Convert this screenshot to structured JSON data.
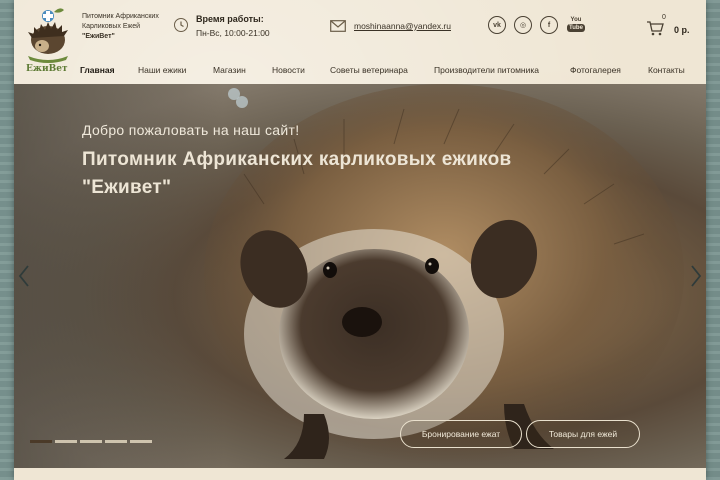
{
  "logo": {
    "name": "ЕжиВет",
    "text_line1": "Питомник Африканских",
    "text_line2": "Карликовых Ежей",
    "text_line3": "\"ЕжиВет\""
  },
  "hours": {
    "title": "Время работы:",
    "value": "Пн-Вс, 10:00-21:00"
  },
  "email": "moshinaanna@yandex.ru",
  "socials": [
    {
      "name": "vk",
      "label": "vk"
    },
    {
      "name": "instagram",
      "label": "◎"
    },
    {
      "name": "facebook",
      "label": "f"
    },
    {
      "name": "youtube",
      "label_top": "You",
      "label_bottom": "Tube"
    }
  ],
  "cart": {
    "count": "0",
    "total": "0 р."
  },
  "nav": [
    {
      "label": "Главная",
      "active": true
    },
    {
      "label": "Наши ежики"
    },
    {
      "label": "Магазин"
    },
    {
      "label": "Новости"
    },
    {
      "label": "Советы ветеринара"
    },
    {
      "label": "Производители питомника"
    },
    {
      "label": "Фотогалерея"
    },
    {
      "label": "Контакты"
    }
  ],
  "hero": {
    "welcome": "Добро пожаловать на наш сайт!",
    "title_line1": "Питомник Африканских карликовых ежиков",
    "title_line2": "\"Еживет\"",
    "btn_booking": "Бронирование ежат",
    "btn_products": "Товары для ежей",
    "slide_count": 5,
    "active_slide": 1
  },
  "colors": {
    "paper": "#efe6d4",
    "text_dark": "#3a3226",
    "hero_text": "#ede5d5"
  }
}
